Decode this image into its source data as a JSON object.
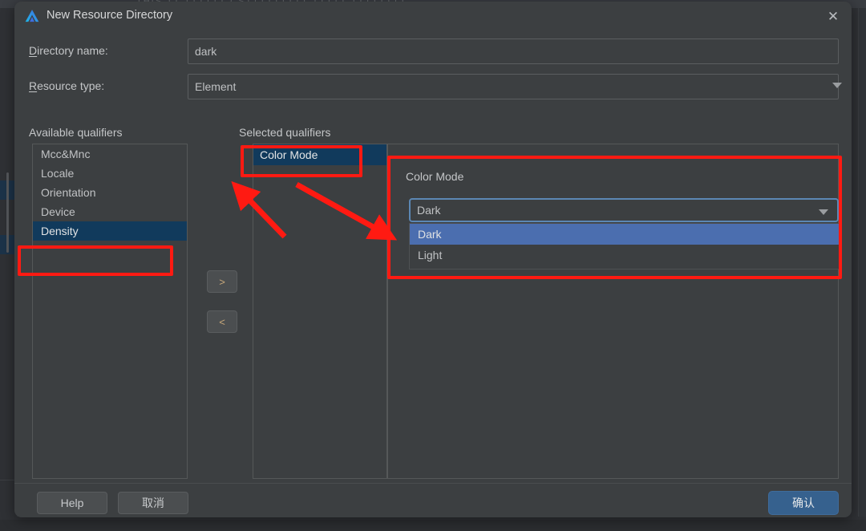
{
  "background": {
    "top_strip_text": "THIS   TT  TTTTTT  CSTTTTTTTTT  TTTTT    TTTTTTTT"
  },
  "dialog": {
    "title": "New Resource Directory",
    "app_icon": "deveco-logo-icon",
    "close_icon": "close-icon"
  },
  "form": {
    "directory_name": {
      "label_mnemonic": "D",
      "label_rest": "irectory name:",
      "value": "dark"
    },
    "resource_type": {
      "label_mnemonic": "R",
      "label_rest": "esource type:",
      "value": "Element",
      "arrow_icon": "chevron-down-icon",
      "options": [
        "Element"
      ]
    }
  },
  "qualifiers": {
    "available_caption": "Available qualifiers",
    "selected_caption": "Selected qualifiers",
    "available_items": [
      {
        "label": "Mcc&Mnc",
        "selected": false
      },
      {
        "label": "Locale",
        "selected": false
      },
      {
        "label": "Orientation",
        "selected": false
      },
      {
        "label": "Device",
        "selected": false
      },
      {
        "label": "Density",
        "selected": true
      }
    ],
    "selected_items": [
      {
        "label": "Color Mode",
        "selected": true
      }
    ],
    "transfer_right_label": ">",
    "transfer_left_label": "<"
  },
  "detail": {
    "title": "Color Mode",
    "combo": {
      "value": "Dark",
      "arrow_icon": "chevron-down-icon",
      "options": [
        {
          "label": "Dark",
          "highlighted": true
        },
        {
          "label": "Light",
          "highlighted": false
        }
      ]
    }
  },
  "footer": {
    "help_label": "Help",
    "cancel_label": "取消",
    "ok_label": "确认"
  },
  "colors": {
    "dialog_bg": "#3c3f41",
    "list_selection": "#113a5c",
    "dropdown_highlight": "#4b6eaf",
    "accent_button": "#36618e",
    "focus_border": "#5b87b4",
    "annotation_red": "#ff1a12"
  }
}
